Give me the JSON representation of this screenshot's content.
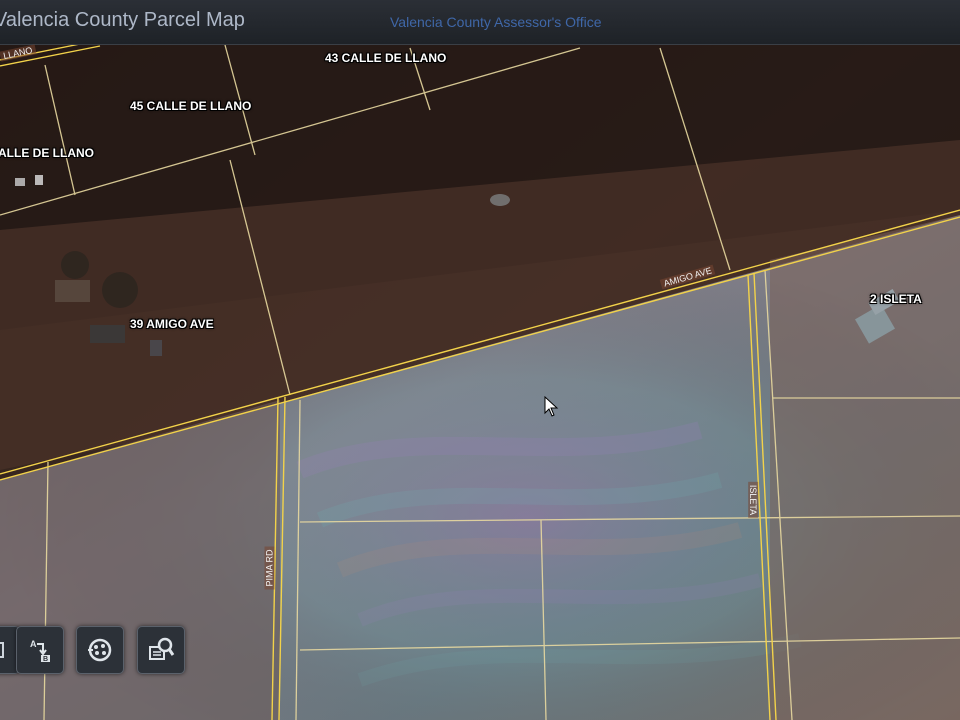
{
  "header": {
    "title": "Valencia County Parcel Map",
    "subtitle": "Valencia County Assessor's Office"
  },
  "parcel_labels": [
    "43 CALLE DE LLANO",
    "45 CALLE DE LLANO",
    "ALLE DE LLANO",
    "39 AMIGO AVE",
    "2 ISLETA"
  ],
  "road_labels": {
    "amigo": "AMIGO AVE",
    "pima": "PIMA RD",
    "isleta": "ISLETA",
    "top_left": "LLANO"
  },
  "toolbar": {
    "buttons": [
      "directions-icon",
      "layers-icon",
      "identify-icon"
    ]
  },
  "colors": {
    "parcel_line": "#e8d9a0",
    "road_line": "#f2d24a",
    "header_bg": "#1e2227",
    "title_text": "#aeb8c8",
    "subtitle_text": "#3f67a8"
  }
}
